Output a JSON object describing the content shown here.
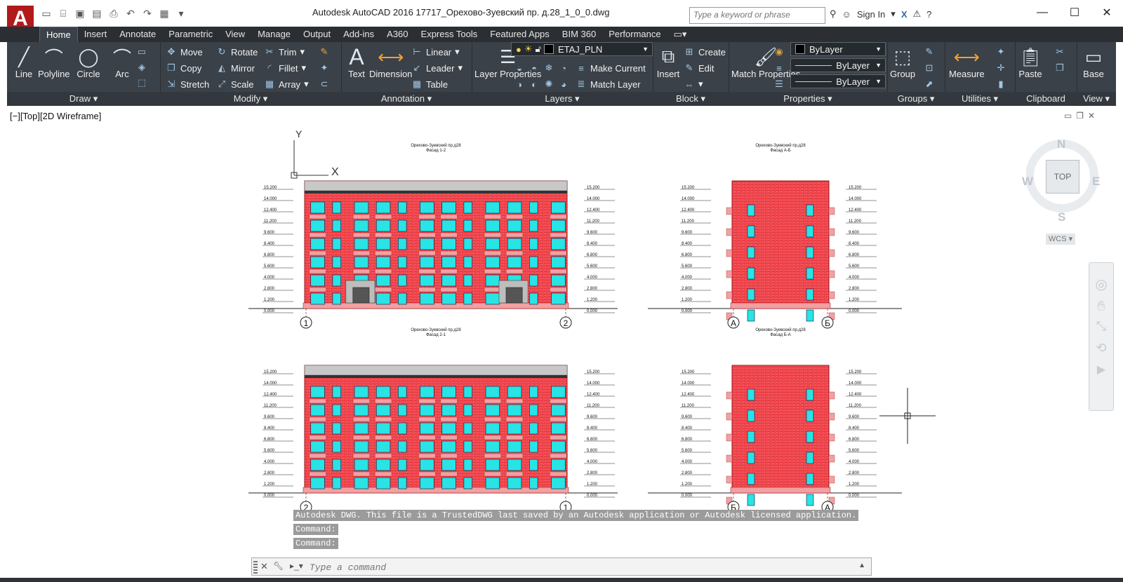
{
  "window": {
    "title": "Autodesk AutoCAD 2016     17717_Орехово-Зуевский пр. д.28_1_0_0.dwg",
    "app_menu_letter": "A",
    "search_placeholder": "Type a keyword or phrase",
    "sign_in": "Sign In"
  },
  "tabs": [
    "Home",
    "Insert",
    "Annotate",
    "Parametric",
    "View",
    "Manage",
    "Output",
    "Add-ins",
    "A360",
    "Express Tools",
    "Featured Apps",
    "BIM 360",
    "Performance"
  ],
  "ribbon": {
    "draw": {
      "title": "Draw",
      "line": "Line",
      "polyline": "Polyline",
      "circle": "Circle",
      "arc": "Arc"
    },
    "modify": {
      "title": "Modify",
      "move": "Move",
      "rotate": "Rotate",
      "trim": "Trim",
      "copy": "Copy",
      "mirror": "Mirror",
      "fillet": "Fillet",
      "stretch": "Stretch",
      "scale": "Scale",
      "array": "Array"
    },
    "annotation": {
      "title": "Annotation",
      "text": "Text",
      "dimension": "Dimension",
      "linear": "Linear",
      "leader": "Leader",
      "table": "Table"
    },
    "layers": {
      "title": "Layers",
      "layer_properties": "Layer Properties",
      "current_layer": "ETAJ_PLN",
      "make_current": "Make Current",
      "match_layer": "Match Layer"
    },
    "block": {
      "title": "Block",
      "insert": "Insert",
      "create": "Create",
      "edit": "Edit"
    },
    "properties": {
      "title": "Properties",
      "match_properties": "Match Properties",
      "color": "ByLayer",
      "linetype": "ByLayer",
      "lineweight": "ByLayer"
    },
    "groups": {
      "title": "Groups",
      "group": "Group"
    },
    "utilities": {
      "title": "Utilities",
      "measure": "Measure"
    },
    "clipboard": {
      "title": "Clipboard",
      "paste": "Paste"
    },
    "view": {
      "title": "View",
      "base": "Base"
    }
  },
  "viewport": {
    "label": "[−][Top][2D Wireframe]",
    "viewcube": {
      "top": "TOP",
      "n": "N",
      "s": "S",
      "e": "E",
      "w": "W"
    },
    "wcs": "WCS"
  },
  "drawing": {
    "ucs_x": "X",
    "ucs_y": "Y",
    "elevations": [
      {
        "name": "elev-1-2",
        "title": "Орехово-Зуевский пр.д28",
        "subtitle": "Фасад 1-2",
        "axis_left": "1",
        "axis_right": "2"
      },
      {
        "name": "elev-a-b",
        "title": "Орехово-Зуевский пр.д28",
        "subtitle": "Фасад А-Б",
        "axis_left": "А",
        "axis_right": "Б"
      },
      {
        "name": "elev-2-1",
        "title": "Орехово-Зуевский пр.д28",
        "subtitle": "Фасад 2-1",
        "axis_left": "2",
        "axis_right": "1"
      },
      {
        "name": "elev-b-a",
        "title": "Орехово-Зуевский пр.д28",
        "subtitle": "Фасад Б-А",
        "axis_left": "Б",
        "axis_right": "А"
      }
    ],
    "level_marks": [
      "15.200",
      "14.000",
      "12.400",
      "11.200",
      "9.600",
      "8.400",
      "6.800",
      "5.600",
      "4.000",
      "2.800",
      "1.200",
      "0.000"
    ],
    "colors": {
      "brick": "#e8333a",
      "window": "#28e4e4",
      "grid": "#ff9aa0",
      "panel": "#f2a0a2"
    }
  },
  "command": {
    "history": [
      "Autodesk DWG.  This file is a TrustedDWG last saved by an Autodesk application or Autodesk licensed application.",
      "Command:",
      "Command:"
    ],
    "placeholder": "Type a command"
  }
}
